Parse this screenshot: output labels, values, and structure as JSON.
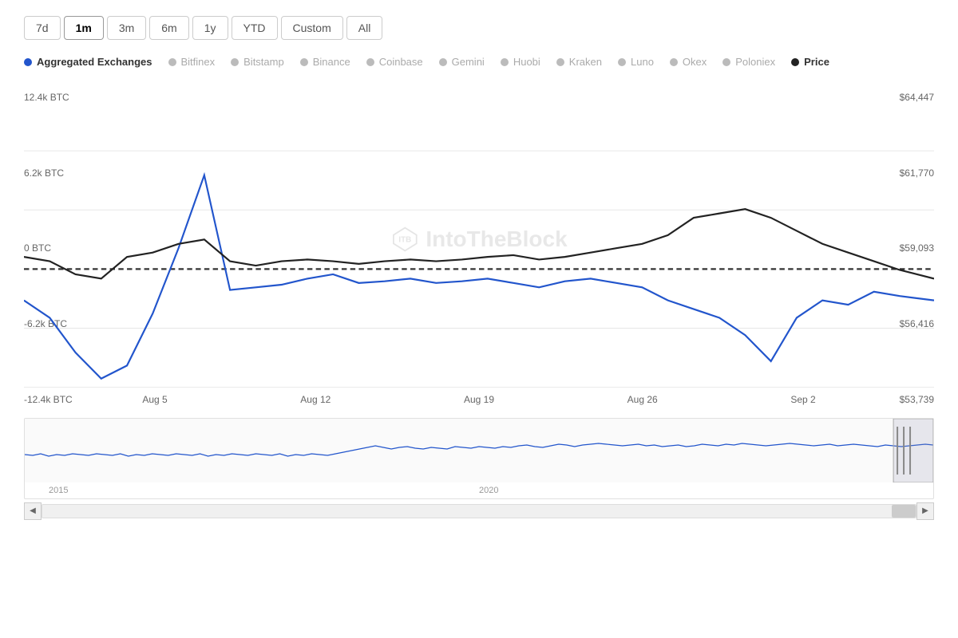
{
  "timeButtons": [
    {
      "label": "7d",
      "active": false
    },
    {
      "label": "1m",
      "active": true
    },
    {
      "label": "3m",
      "active": false
    },
    {
      "label": "6m",
      "active": false
    },
    {
      "label": "1y",
      "active": false
    },
    {
      "label": "YTD",
      "active": false
    },
    {
      "label": "Custom",
      "active": false
    },
    {
      "label": "All",
      "active": false
    }
  ],
  "legend": [
    {
      "label": "Aggregated Exchanges",
      "color": "#2255cc",
      "active": true
    },
    {
      "label": "Bitfinex",
      "color": "#bbb",
      "active": false
    },
    {
      "label": "Bitstamp",
      "color": "#bbb",
      "active": false
    },
    {
      "label": "Binance",
      "color": "#bbb",
      "active": false
    },
    {
      "label": "Coinbase",
      "color": "#bbb",
      "active": false
    },
    {
      "label": "Gemini",
      "color": "#bbb",
      "active": false
    },
    {
      "label": "Huobi",
      "color": "#bbb",
      "active": false
    },
    {
      "label": "Kraken",
      "color": "#bbb",
      "active": false
    },
    {
      "label": "Luno",
      "color": "#bbb",
      "active": false
    },
    {
      "label": "Okex",
      "color": "#bbb",
      "active": false
    },
    {
      "label": "Poloniex",
      "color": "#bbb",
      "active": false
    },
    {
      "label": "Price",
      "color": "#222",
      "active": true
    }
  ],
  "yAxisLeft": [
    "12.4k BTC",
    "6.2k BTC",
    "0 BTC",
    "-6.2k BTC",
    "-12.4k BTC"
  ],
  "yAxisRight": [
    "$64,447",
    "$61,770",
    "$59,093",
    "$56,416",
    "$53,739"
  ],
  "xAxisLabels": [
    "Aug 5",
    "Aug 12",
    "Aug 19",
    "Aug 26",
    "Sep 2"
  ],
  "miniChartLabels": [
    "2015",
    "2020"
  ],
  "watermark": "IntoTheBlock"
}
